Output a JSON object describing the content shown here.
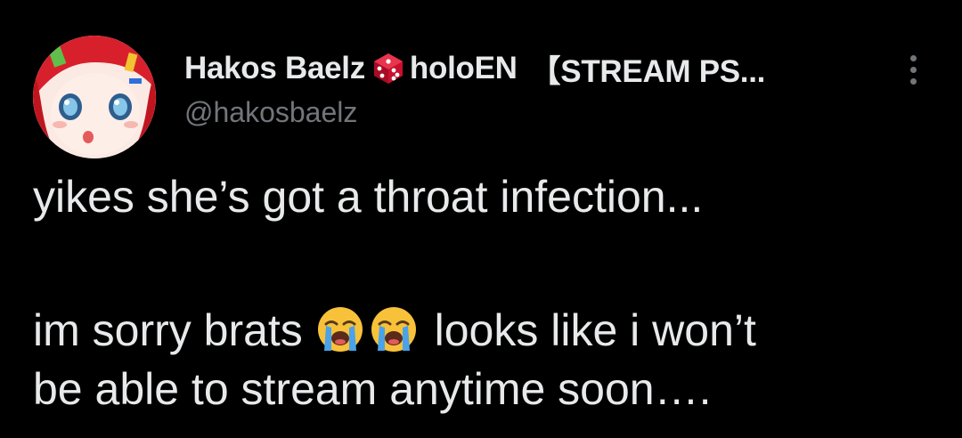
{
  "tweet": {
    "display_name": "Hakos Baelz",
    "name_suffix": "holoEN",
    "name_tag": "【STREAM PS...",
    "handle": "@hakosbaelz",
    "avatar_icon": "avatar-image",
    "badge_icon": "dice-icon",
    "more_icon": "more-options-icon",
    "lines": {
      "line1": "yikes she’s got a throat infection...",
      "line2_start": "im sorry brats",
      "line2_end": "looks like i won’t",
      "line3": "be able to stream anytime soon…."
    },
    "emoji_icon": "loudly-crying-face-emoji"
  },
  "colors": {
    "background": "#000000",
    "text_primary": "#e7e9ea",
    "text_secondary": "#71767b",
    "dice_red": "#c8102e"
  }
}
